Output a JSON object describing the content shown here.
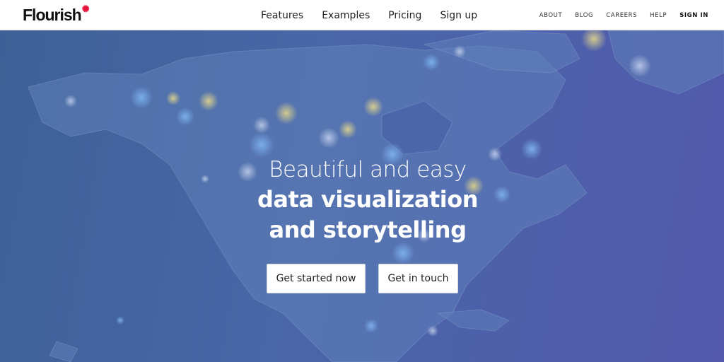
{
  "brand": {
    "name": "Flourish",
    "mark": "✺",
    "accent": "#e8143c"
  },
  "nav": {
    "main": [
      "Features",
      "Examples",
      "Pricing",
      "Sign up"
    ],
    "secondary": [
      "ABOUT",
      "BLOG",
      "CAREERS",
      "HELP",
      "SIGN IN"
    ]
  },
  "hero": {
    "line1": "Beautiful and easy",
    "line2": "data visualization",
    "line3": "and storytelling",
    "buttons": {
      "primary": "Get started now",
      "secondary": "Get in touch"
    },
    "background_color": "#4a5fa6"
  }
}
